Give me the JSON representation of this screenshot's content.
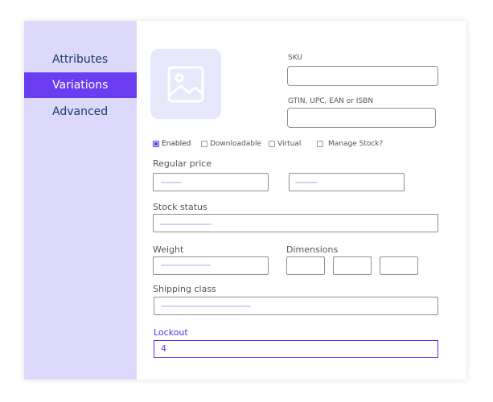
{
  "sidebar": {
    "items": [
      {
        "label": "Attributes",
        "active": false
      },
      {
        "label": "Variations",
        "active": true
      },
      {
        "label": "Advanced",
        "active": false
      }
    ]
  },
  "fields": {
    "sku_label": "SKU",
    "gtin_label": "GTIN, UPC, EAN or ISBN",
    "regular_price_label": "Regular price",
    "stock_status_label": "Stock status",
    "weight_label": "Weight",
    "dimensions_label": "Dimensions",
    "shipping_class_label": "Shipping class",
    "lockout_label": "Lockout",
    "lockout_value": "4"
  },
  "checkboxes": [
    {
      "label": "Enabled",
      "checked": true
    },
    {
      "label": "Downloadable",
      "checked": false
    },
    {
      "label": "Virtual",
      "checked": false
    },
    {
      "label": "Manage Stock?",
      "checked": false
    }
  ],
  "colors": {
    "accent": "#5b2ee8",
    "sidebar_bg": "#dcd9fb",
    "image_placeholder_bg": "#e8e8fd"
  },
  "icons": {
    "image_placeholder": "image-icon"
  }
}
